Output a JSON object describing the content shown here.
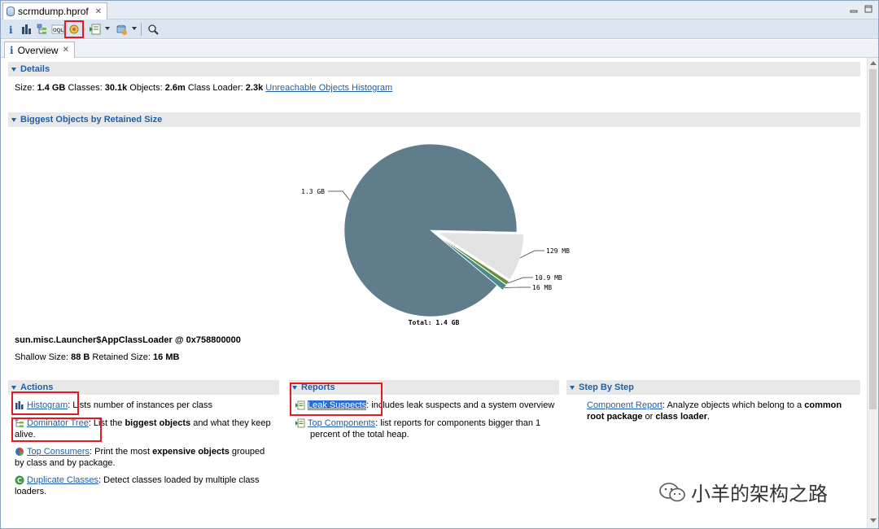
{
  "editor_tab": {
    "title": "scrmdump.hprof",
    "close": "✕"
  },
  "window_controls": {
    "minimize": "▭",
    "maximize": "▭"
  },
  "toolbar": {
    "items": [
      "info-icon",
      "histogram-icon",
      "dominator-tree-icon",
      "oql-icon",
      "heap-dump-analyzer-icon",
      "run-report-icon",
      "query-browser-icon",
      "search-icon"
    ],
    "oql_label": "OQL"
  },
  "subtab": {
    "icon": "i",
    "title": "Overview",
    "close": "✕"
  },
  "details": {
    "header": "Details",
    "size_label": "Size:",
    "size_value": "1.4 GB",
    "classes_label": "Classes:",
    "classes_value": "30.1k",
    "objects_label": "Objects:",
    "objects_value": "2.6m",
    "classloader_label": "Class Loader:",
    "classloader_value": "2.3k",
    "unreachable_link": "Unreachable Objects Histogram"
  },
  "biggest": {
    "header": "Biggest Objects by Retained Size",
    "object_name": "sun.misc.Launcher$AppClassLoader @ 0x758800000",
    "shallow_label": "Shallow Size:",
    "shallow_value": "88 B",
    "retained_label": "Retained Size:",
    "retained_value": "16 MB"
  },
  "chart_data": {
    "type": "pie",
    "slices": [
      {
        "label": "1.3 GB",
        "value": 1300,
        "color": "#607d8b"
      },
      {
        "label": "129 MB",
        "value": 129,
        "color": "#e3e3e3"
      },
      {
        "label": "10.9 MB",
        "value": 10.9,
        "color": "#6b8e3a"
      },
      {
        "label": "16 MB",
        "value": 16,
        "color": "#4a8a8a"
      }
    ],
    "total_label": "Total: 1.4 GB"
  },
  "actions": {
    "header": "Actions",
    "items": [
      {
        "link": "Histogram",
        "text": ": Lists number of instances per class"
      },
      {
        "link": "Dominator Tree",
        "text_pre": ": List the ",
        "bold": "biggest objects",
        "text_post": " and what they keep alive."
      },
      {
        "link": "Top Consumers",
        "text_pre": ": Print the most ",
        "bold": "expensive objects",
        "text_post": " grouped by class and by package."
      },
      {
        "link": "Duplicate Classes",
        "text": ": Detect classes loaded by multiple class loaders."
      }
    ]
  },
  "reports": {
    "header": "Reports",
    "items": [
      {
        "link": "Leak Suspects",
        "text": ": includes leak suspects and a system overview"
      },
      {
        "link": "Top Components",
        "text": ": list reports for components bigger than 1 percent of the total heap."
      }
    ]
  },
  "stepbystep": {
    "header": "Step By Step",
    "link": "Component Report",
    "text_pre": ": Analyze objects which belong to a ",
    "bold1": "common root package",
    "text_mid": " or ",
    "bold2": "class loader",
    "text_post": "."
  },
  "watermark": {
    "text": "小羊的架构之路"
  }
}
